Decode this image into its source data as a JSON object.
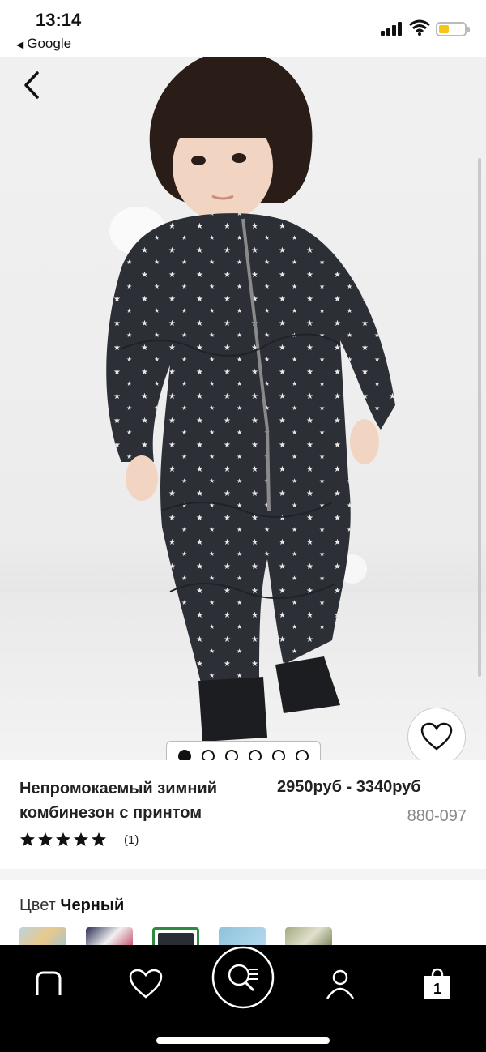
{
  "status_bar": {
    "time": "13:14",
    "back_app": "Google"
  },
  "hero": {
    "image_alt": "Toddler wearing black star-print quilted snowsuit",
    "carousel_total": 6,
    "carousel_active": 1
  },
  "product": {
    "title": "Непромокаемый зимний комбинезон с принтом",
    "price": "2950руб - 3340руб",
    "sku": "880-097",
    "rating": 5,
    "reviews": "(1)"
  },
  "color": {
    "label": "Цвет",
    "value": "Черный",
    "swatches": [
      "light-blue-print",
      "navy-print",
      "black",
      "light-blue",
      "olive-print"
    ]
  },
  "tabbar": {
    "items": [
      "home-icon",
      "heart-icon",
      "search-icon",
      "account-icon",
      "bag-icon"
    ],
    "bag_count": "1"
  },
  "colors": {
    "accent_selected": "#2e8b3c",
    "tabbar_bg": "#000000",
    "battery": "#f5c518"
  }
}
